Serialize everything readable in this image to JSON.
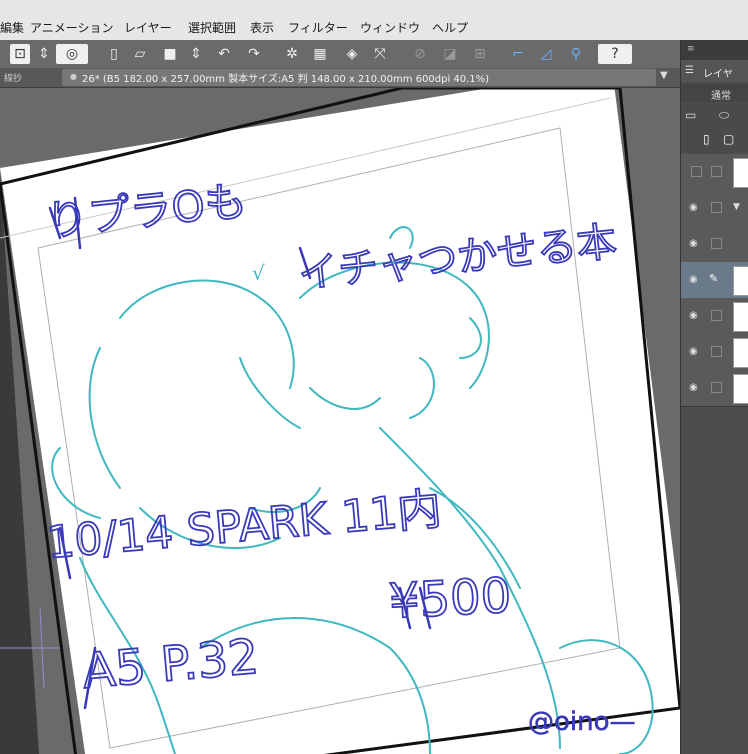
{
  "menu": {
    "items": [
      "編集",
      "アニメーション",
      "レイヤー",
      "選択範囲",
      "表示",
      "フィルター",
      "ウィンドウ",
      "ヘルプ"
    ]
  },
  "tab": {
    "left_label": "線抄",
    "title": "26* (B5 182.00 x 257.00mm 製本サイズ:A5 判 148.00 x 210.00mm 600dpi 40.1%)"
  },
  "panel": {
    "tab_label": "レイヤ",
    "blend_mode": "通常"
  },
  "artwork": {
    "title_line1": "りプラOも",
    "title_line2": "イチャつかせる本",
    "event": "10/14 SPARK 11内",
    "price": "¥500",
    "format": "A5 P.32",
    "handle": "@oino—"
  },
  "colors": {
    "ink_blue": "#3a3ab8",
    "ink_teal": "#3fb8c0",
    "paper": "#ffffff"
  }
}
